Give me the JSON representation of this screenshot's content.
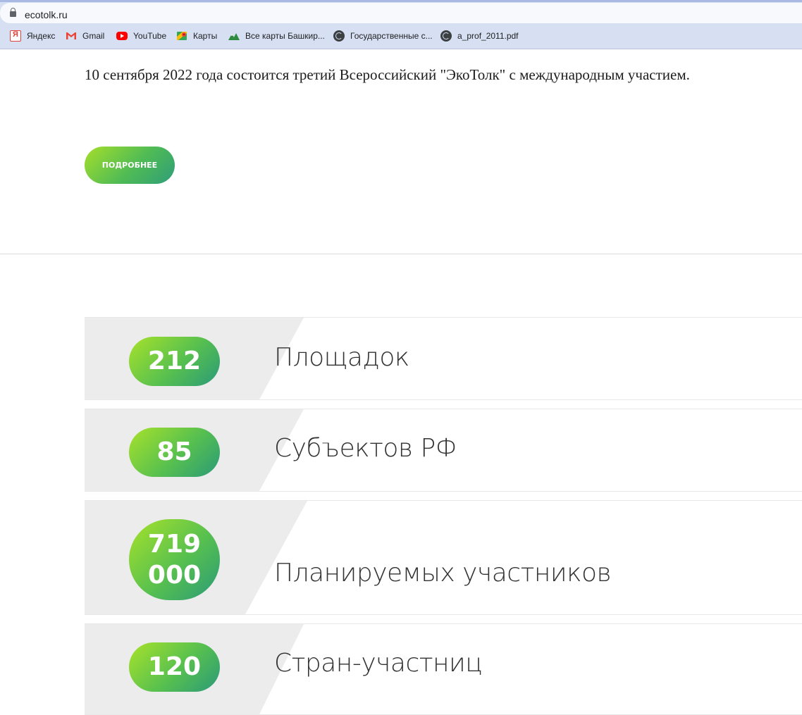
{
  "browser": {
    "url": "ecotolk.ru",
    "bookmarks": [
      {
        "label": "Яндекс",
        "icon": "yandex-icon"
      },
      {
        "label": "Gmail",
        "icon": "gmail-icon"
      },
      {
        "label": "YouTube",
        "icon": "youtube-icon"
      },
      {
        "label": "Карты",
        "icon": "maps-icon"
      },
      {
        "label": "Все карты Башкир...",
        "icon": "mountain-icon"
      },
      {
        "label": "Государственные с...",
        "icon": "globe-icon"
      },
      {
        "label": "a_prof_2011.pdf",
        "icon": "globe-icon"
      }
    ]
  },
  "page": {
    "intro_text": "10 сентября 2022 года состоится третий Всероссийский \"ЭкоТолк\" с международным участием.",
    "more_button_label": "ПОДРОБНЕЕ",
    "stats": [
      {
        "value": "212",
        "label": "Площадок"
      },
      {
        "value": "85",
        "label": "Субъектов РФ"
      },
      {
        "value": "719 000",
        "value_line1": "719",
        "value_line2": "000",
        "label": "Планируемых участников"
      },
      {
        "value": "120",
        "label": "Стран-участниц"
      }
    ]
  },
  "colors": {
    "accent_start": "#a8e22a",
    "accent_end": "#2a9a78",
    "row_gray": "#ececec",
    "chrome": "#d7e0f2"
  }
}
